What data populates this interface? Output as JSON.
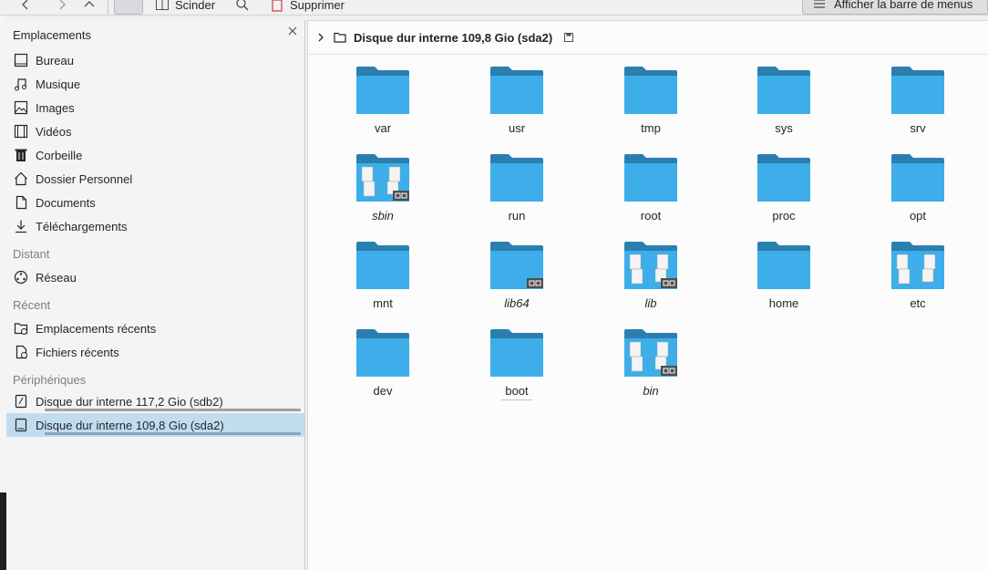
{
  "toolbar": {
    "split_label": "Scinder",
    "delete_label": "Supprimer",
    "menubar_label": "Afficher la barre de menus"
  },
  "sidebar": {
    "header": "Emplacements",
    "places": [
      {
        "label": "Bureau",
        "icon": "desktop-icon"
      },
      {
        "label": "Musique",
        "icon": "music-icon"
      },
      {
        "label": "Images",
        "icon": "image-icon"
      },
      {
        "label": "Vidéos",
        "icon": "video-icon"
      },
      {
        "label": "Corbeille",
        "icon": "trash-icon"
      },
      {
        "label": "Dossier Personnel",
        "icon": "home-icon"
      },
      {
        "label": "Documents",
        "icon": "document-icon"
      },
      {
        "label": "Téléchargements",
        "icon": "download-icon"
      }
    ],
    "remote_section": "Distant",
    "remote": [
      {
        "label": "Réseau",
        "icon": "network-icon"
      }
    ],
    "recent_section": "Récent",
    "recent": [
      {
        "label": "Emplacements récents",
        "icon": "recent-folder-icon"
      },
      {
        "label": "Fichiers récents",
        "icon": "recent-file-icon"
      }
    ],
    "devices_section": "Périphériques",
    "devices": [
      {
        "label": "Disque dur interne 117,2 Gio (sdb2)",
        "icon": "harddisk-icon"
      },
      {
        "label": "Disque dur interne 109,8 Gio (sda2)",
        "icon": "harddisk-icon",
        "active": true
      }
    ]
  },
  "breadcrumb": {
    "label": "Disque dur interne 109,8 Gio (sda2)"
  },
  "files": [
    {
      "name": "var"
    },
    {
      "name": "usr"
    },
    {
      "name": "tmp"
    },
    {
      "name": "sys"
    },
    {
      "name": "srv"
    },
    {
      "name": "sbin",
      "link": true,
      "docs": true
    },
    {
      "name": "run"
    },
    {
      "name": "root"
    },
    {
      "name": "proc"
    },
    {
      "name": "opt"
    },
    {
      "name": "mnt"
    },
    {
      "name": "lib64",
      "link": true
    },
    {
      "name": "lib",
      "link": true,
      "docs": true
    },
    {
      "name": "home"
    },
    {
      "name": "etc",
      "docs": true
    },
    {
      "name": "dev"
    },
    {
      "name": "boot"
    },
    {
      "name": "bin",
      "link": true,
      "docs": true
    }
  ],
  "colors": {
    "folder_body": "#3daee9",
    "folder_tab": "#2b7fb0",
    "selection": "#c2dcef"
  }
}
